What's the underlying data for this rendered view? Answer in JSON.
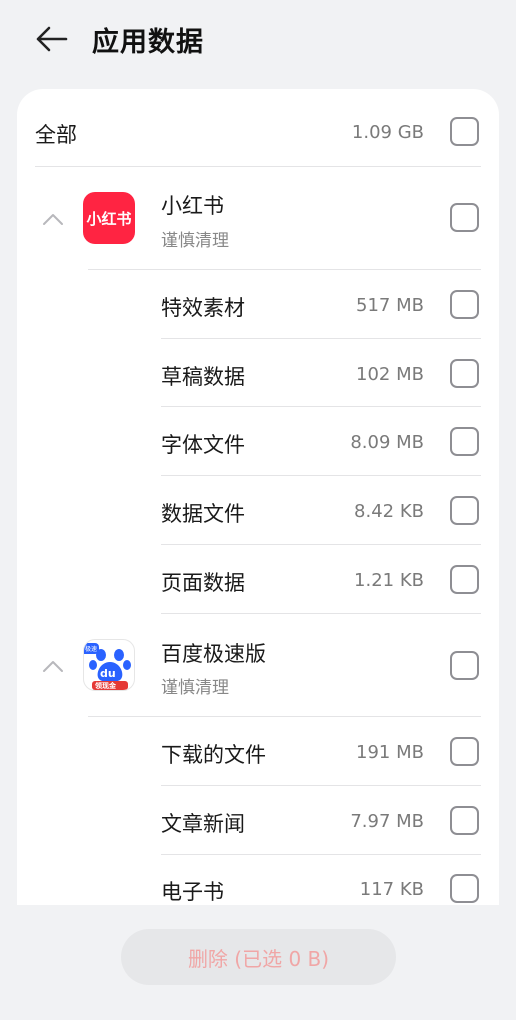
{
  "header": {
    "title": "应用数据",
    "back_icon": "back-arrow-icon"
  },
  "all": {
    "label": "全部",
    "size": "1.09 GB"
  },
  "apps": [
    {
      "name": "小红书",
      "subtitle": "谨慎清理",
      "icon_text": "小红书",
      "icon_color": "#ff2442",
      "items": [
        {
          "label": "特效素材",
          "size": "517 MB"
        },
        {
          "label": "草稿数据",
          "size": "102 MB"
        },
        {
          "label": "字体文件",
          "size": "8.09 MB"
        },
        {
          "label": "数据文件",
          "size": "8.42 KB"
        },
        {
          "label": "页面数据",
          "size": "1.21 KB"
        }
      ]
    },
    {
      "name": "百度极速版",
      "subtitle": "谨慎清理",
      "icon_text": "du",
      "icon_badge": "领现金",
      "icon_corner": "极速",
      "icon_color": "#2a62ff",
      "items": [
        {
          "label": "下载的文件",
          "size": "191 MB"
        },
        {
          "label": "文章新闻",
          "size": "7.97 MB"
        },
        {
          "label": "电子书",
          "size": "117 KB"
        }
      ]
    }
  ],
  "footer": {
    "delete_label": "删除 (已选 0 B)"
  },
  "colors": {
    "background": "#f1f2f4",
    "card": "#ffffff",
    "delete_text": "#f0a6a6"
  }
}
